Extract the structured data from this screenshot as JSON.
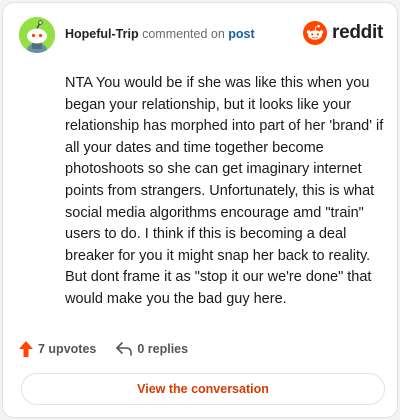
{
  "header": {
    "username": "Hopeful-Trip",
    "action_text": "commented on",
    "post_link": "post"
  },
  "brand": {
    "wordmark": "reddit",
    "color": "#ff4500"
  },
  "comment": {
    "text": "NTA You would be if she was like this when you began your relationship, but it looks like your relationship has morphed into part of her 'brand' if all your dates and time together become photoshoots so she can get imaginary internet points from strangers. Unfortunately, this is what social media algorithms encourage amd \"train\" users to do. I think if this is becoming a deal breaker for you it might snap her back to reality. But dont frame it as \"stop it our we're done\" that would make you the bad guy here."
  },
  "actions": {
    "upvotes": "7 upvotes",
    "replies": "0 replies"
  },
  "cta": {
    "label": "View the conversation"
  },
  "icons": {
    "avatar": "snoo-avatar-icon",
    "upvote": "upvote-arrow-icon",
    "reply": "reply-arrow-icon",
    "logo": "reddit-snoo-icon"
  },
  "colors": {
    "avatar_bg": "#94e044",
    "upvote": "#ff4500",
    "link": "#1a5ea8",
    "cta_text": "#d93a00"
  }
}
